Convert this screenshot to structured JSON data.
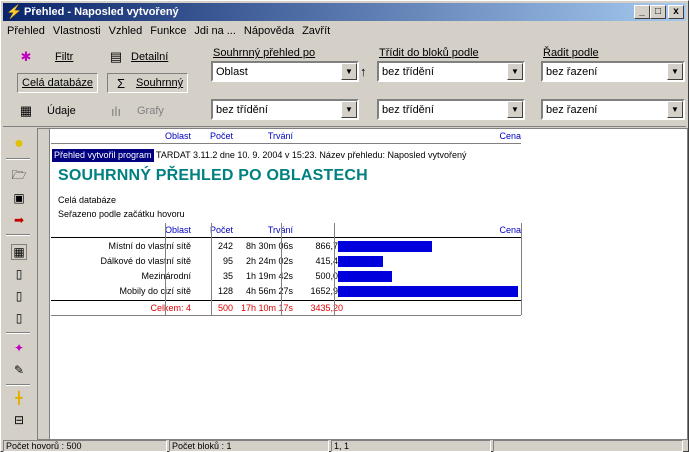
{
  "window": {
    "title": "Přehled - Naposled vytvořený",
    "controls": [
      "_",
      "□",
      "x"
    ]
  },
  "menu": [
    "Přehled",
    "Vlastnosti",
    "Vzhled",
    "Funkce",
    "Jdi na ...",
    "Nápověda",
    "Zavřít"
  ],
  "toolbar": {
    "filtr": "Filtr",
    "detailni": "Detailní",
    "cela_databaze": "Celá databáze",
    "souhrnny": "Souhrnný",
    "udaje": "Údaje",
    "grafy": "Grafy",
    "summary_by_label": "Souhrnný přehled po",
    "sort_blocks_label": "Třídit do bloků podle",
    "order_label": "Řadit podle",
    "summary_by_value": "Oblast",
    "summary_by_value2": "bez třídění",
    "sort_blocks_value": "bez třídění",
    "sort_blocks_value2": "bez třídění",
    "order_value": "bez řazení",
    "order_value2": "bez řazení"
  },
  "report": {
    "col_headers": {
      "oblast": "Oblast",
      "pocet": "Počet",
      "trvani": "Trvání",
      "cena": "Cena"
    },
    "info_label": "Přehled vytvořil program",
    "info_text": "TARDAT 3.11.2 dne 10. 9. 2004 v 15:23. Název přehledu: Naposled vytvořený",
    "title": "SOUHRNNÝ PŘEHLED PO OBLASTECH",
    "note1": "Celá databáze",
    "note2": "Seřazeno podle začátku hovoru",
    "rows": [
      {
        "oblast": "Místní do vlastní sítě",
        "pocet": "242",
        "trvani": "8h 30m 06s",
        "cena": "866,74",
        "value": 866.74
      },
      {
        "oblast": "Dálkové do vlastní sítě",
        "pocet": "95",
        "trvani": "2h 24m 02s",
        "cena": "415,46",
        "value": 415.46
      },
      {
        "oblast": "Mezinárodní",
        "pocet": "35",
        "trvani": "1h 19m 42s",
        "cena": "500,01",
        "value": 500.01
      },
      {
        "oblast": "Mobily do cizí sítě",
        "pocet": "128",
        "trvani": "4h 56m 27s",
        "cena": "1652,99",
        "value": 1652.99
      }
    ],
    "total": {
      "oblast": "Celkem: 4",
      "pocet": "500",
      "trvani": "17h 10m 17s",
      "cena": "3435,20"
    }
  },
  "status": {
    "calls": "Počet hovorů : 500",
    "blocks": "Počet bloků : 1",
    "pos": "1, 1"
  },
  "colors": {
    "accent_title": "#008080",
    "bar": "#0000dd",
    "header_blue": "#0000c0",
    "total_red": "#e00000"
  }
}
